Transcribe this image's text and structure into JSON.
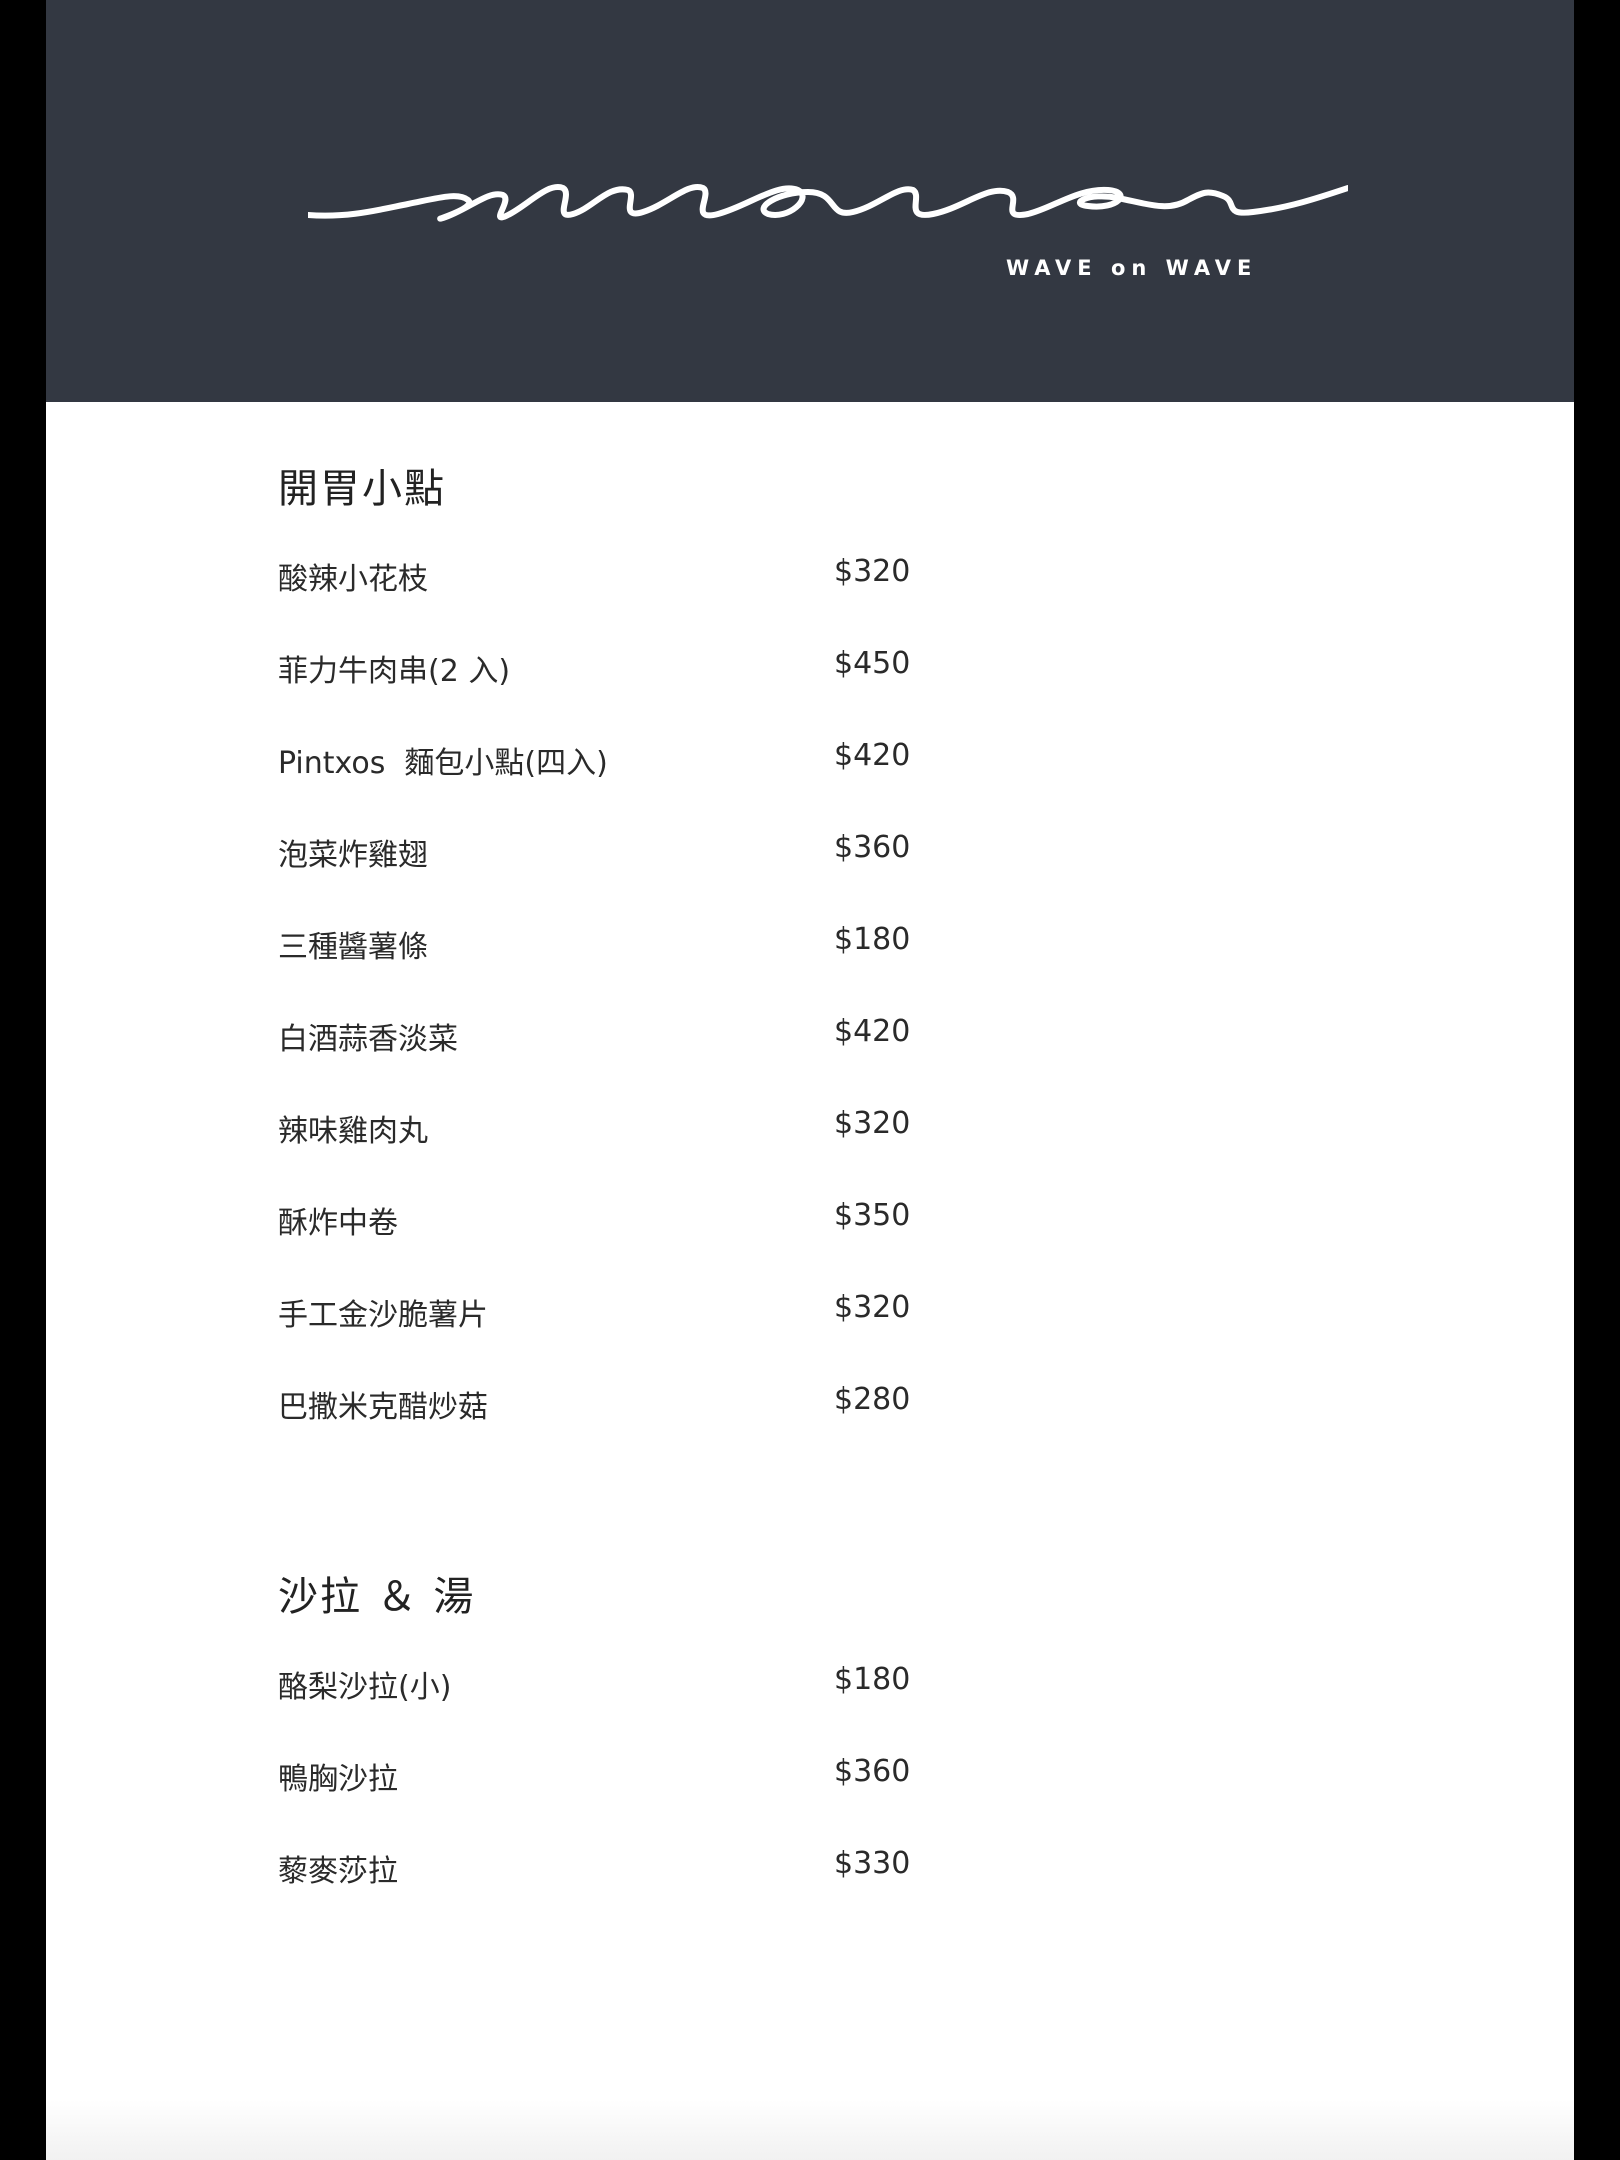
{
  "header": {
    "brand_tagline": "WAVE on WAVE",
    "background_color": "#333842"
  },
  "sections": [
    {
      "title": "開胃小點",
      "items": [
        {
          "name": "酸辣小花枝",
          "price": "$320"
        },
        {
          "name": "菲力牛肉串(2 入)",
          "price": "$450"
        },
        {
          "name": "Pintxos  麵包小點(四入)",
          "price": "$420"
        },
        {
          "name": "泡菜炸雞翅",
          "price": "$360"
        },
        {
          "name": "三種醬薯條",
          "price": "$180"
        },
        {
          "name": "白酒蒜香淡菜",
          "price": "$420"
        },
        {
          "name": "辣味雞肉丸",
          "price": "$320"
        },
        {
          "name": "酥炸中卷",
          "price": "$350"
        },
        {
          "name": "手工金沙脆薯片",
          "price": "$320"
        },
        {
          "name": "巴撒米克醋炒菇",
          "price": "$280"
        }
      ]
    },
    {
      "title": "沙拉 ＆ 湯",
      "items": [
        {
          "name": "酪梨沙拉(小)",
          "price": "$180"
        },
        {
          "name": "鴨胸沙拉",
          "price": "$360"
        },
        {
          "name": "藜麥莎拉",
          "price": "$330"
        }
      ]
    }
  ]
}
